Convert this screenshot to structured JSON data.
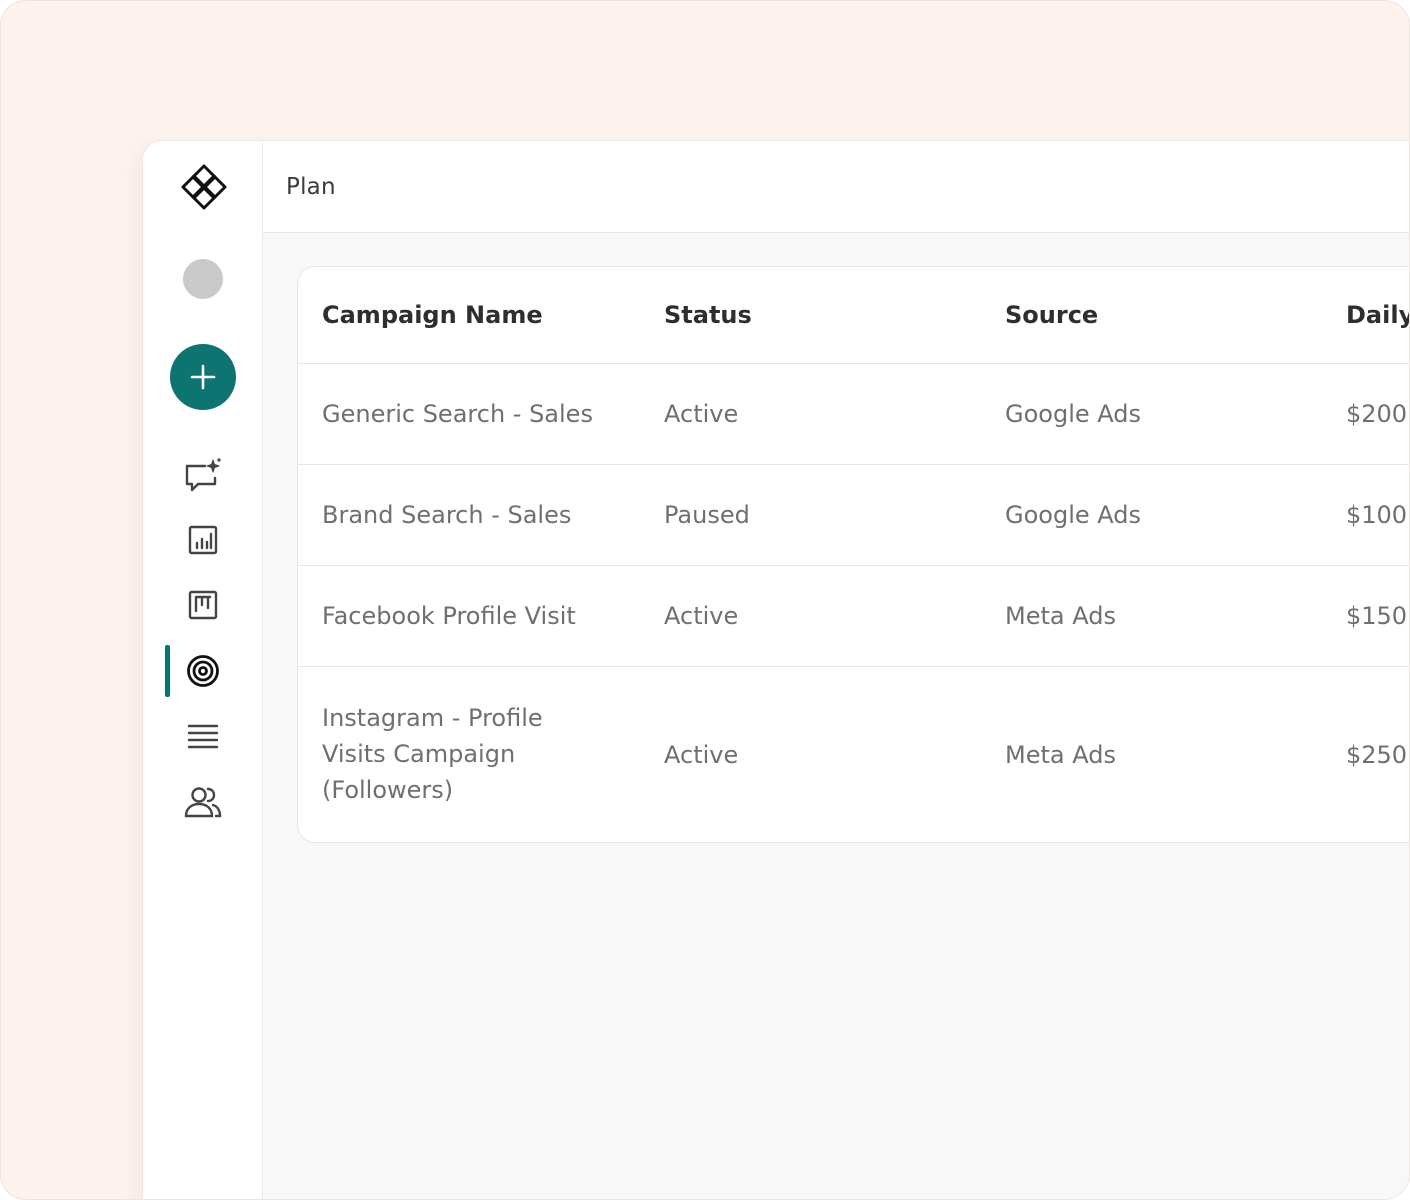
{
  "header": {
    "title": "Plan"
  },
  "sidebar": {
    "items": [
      {
        "name": "ai-chat",
        "icon": "chat-sparkle-icon"
      },
      {
        "name": "reports",
        "icon": "bar-chart-icon"
      },
      {
        "name": "board",
        "icon": "kanban-icon"
      },
      {
        "name": "plan",
        "icon": "target-icon",
        "active": true
      },
      {
        "name": "list",
        "icon": "list-icon"
      },
      {
        "name": "users",
        "icon": "users-icon"
      }
    ]
  },
  "colors": {
    "accent": "#0d7472",
    "background": "#fdf3ee"
  },
  "table": {
    "columns": [
      "Campaign Name",
      "Status",
      "Source",
      "Daily"
    ],
    "rows": [
      {
        "campaign": "Generic Search - Sales",
        "status": "Active",
        "source": "Google Ads",
        "daily": "$200"
      },
      {
        "campaign": "Brand Search - Sales",
        "status": "Paused",
        "source": "Google Ads",
        "daily": "$100"
      },
      {
        "campaign": "Facebook Profile Visit",
        "status": "Active",
        "source": "Meta Ads",
        "daily": "$150"
      },
      {
        "campaign": "Instagram - Profile Visits Campaign (Followers)",
        "status": "Active",
        "source": "Meta Ads",
        "daily": "$250"
      }
    ]
  }
}
